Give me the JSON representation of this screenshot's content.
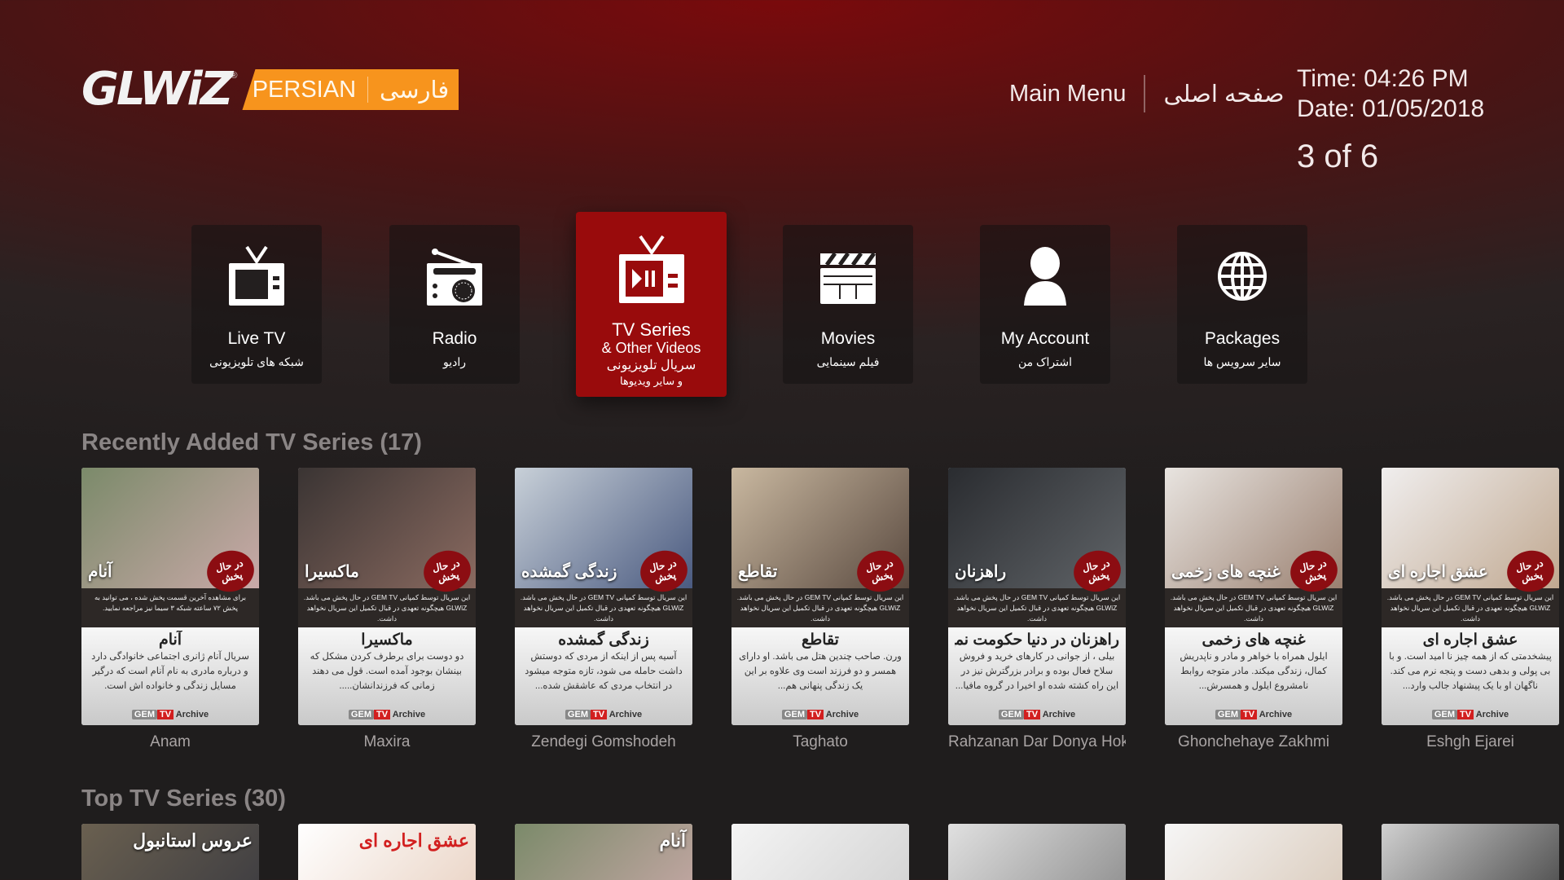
{
  "header": {
    "logo": "GLWiZ",
    "logo_reg": "®",
    "language_en": "PERSIAN",
    "language_fa": "فارسی",
    "main_menu_en": "Main Menu",
    "main_menu_fa": "صفحه اصلی",
    "time": "Time: 04:26 PM",
    "date": "Date: 01/05/2018",
    "pager": "3 of 6"
  },
  "menu": [
    {
      "en": "Live TV",
      "fa": "شبکه های تلویزیونی",
      "icon": "tv-icon"
    },
    {
      "en": "Radio",
      "fa": "رادیو",
      "icon": "radio-icon"
    },
    {
      "en": "TV Series",
      "en2": "& Other Videos",
      "fa": "سریال تلویزیونی",
      "fa2": "و سایر ویدیوها",
      "icon": "tv-play-icon",
      "selected": true
    },
    {
      "en": "Movies",
      "fa": "فیلم سینمایی",
      "icon": "clapperboard-icon"
    },
    {
      "en": "My Account",
      "fa": "اشتراک من",
      "icon": "user-icon"
    },
    {
      "en": "Packages",
      "fa": "سایر سرویس ها",
      "icon": "globe-icon"
    }
  ],
  "colors": {
    "accent": "#990b0c",
    "logo_band": "#f7941d"
  },
  "recent": {
    "title": "Recently Added TV Series (17)",
    "badge": "در حال پخش",
    "archive": "Archive",
    "gem": "GEM",
    "tv": "TV",
    "items": [
      {
        "label": "Anam",
        "poster_title": "آنام",
        "title": "آنام",
        "strip": "برای مشاهده آخرین قسمت پخش شده ، می توانید به پخش ۷۲ ساعته شبکه ۳ سیما نیز مراجعه نمایید.",
        "desc": "سریال آنام ژانری اجتماعی خانوادگی دارد و درباره مادری به نام آنام است که درگیر مسایل زندگی و خانواده اش است."
      },
      {
        "label": "Maxira",
        "poster_title": "ماکسیرا",
        "title": "ماکسیرا",
        "strip": "این سریال توسط کمپانی GEM TV در حال پخش می باشد. GLWiZ هیچگونه تعهدی در قبال تکمیل این سریال نخواهد داشت.",
        "desc": "دو دوست برای برطرف کردن مشکل که بینشان بوجود آمده است. قول می دهند زمانی که فرزندانشان....."
      },
      {
        "label": "Zendegi Gomshodeh",
        "poster_title": "زندگی گمشده",
        "title": "زندگی گمشده",
        "strip": "این سریال توسط کمپانی GEM TV در حال پخش می باشد. GLWiZ هیچگونه تعهدی در قبال تکمیل این سریال نخواهد داشت.",
        "desc": "آسیه پس از اینکه از مردی که دوستش داشت حامله می شود، تازه متوجه میشود در انتخاب مردی که عاشقش شده..."
      },
      {
        "label": "Taghato",
        "poster_title": "تقاطع",
        "title": "تقاطع",
        "strip": "این سریال توسط کمپانی GEM TV در حال پخش می باشد. GLWiZ هیچگونه تعهدی در قبال تکمیل این سریال نخواهد داشت.",
        "desc": "ورن. صاحب چندین هتل می باشد. او دارای همسر و دو فرزند است وی علاوه بر این یک زندگی پنهانی هم..."
      },
      {
        "label": "Rahzanan Dar Donya Hokoomat Nemikonand",
        "poster_title": "راهزنان",
        "title": "راهزنان در دنیا حکومت نمیکنند",
        "strip": "این سریال توسط کمپانی GEM TV در حال پخش می باشد. GLWiZ هیچگونه تعهدی در قبال تکمیل این سریال نخواهد داشت.",
        "desc": "بیلی ، از جوانی در کارهای خرید و فروش سلاح فعال بوده و برادر بزرگترش نیز در این راه کشته شده او اخیرا در گروه مافیا..."
      },
      {
        "label": "Ghonchehaye Zakhmi",
        "poster_title": "غنچه های زخمی",
        "title": "غنچه های زخمی",
        "strip": "این سریال توسط کمپانی GEM TV در حال پخش می باشد. GLWiZ هیچگونه تعهدی در قبال تکمیل این سریال نخواهد داشت.",
        "desc": "ایلول همراه با خواهر و مادر و ناپدریش کمال، زندگی میکند. مادر متوجه روابط نامشروع ایلول و همسرش..."
      },
      {
        "label": "Eshgh Ejarei",
        "poster_title": "عشق اجاره ای",
        "title": "عشق اجاره ای",
        "strip": "این سریال توسط کمپانی GEM TV در حال پخش می باشد. GLWiZ هیچگونه تعهدی در قبال تکمیل این سریال نخواهد داشت.",
        "desc": "پیشخدمتی که از همه چیز نا امید است. و با بی پولی و بدهی دست و پنجه نرم می کند. ناگهان او با یک پیشنهاد جالب وارد..."
      }
    ]
  },
  "top": {
    "title": "Top TV Series (30)",
    "items": [
      {
        "poster_title": "عروس استانبول"
      },
      {
        "poster_title": "عشق اجاره ای"
      },
      {
        "poster_title": "آنام"
      },
      {
        "poster_title": ""
      },
      {
        "poster_title": ""
      },
      {
        "poster_title": ""
      },
      {
        "poster_title": ""
      }
    ]
  }
}
